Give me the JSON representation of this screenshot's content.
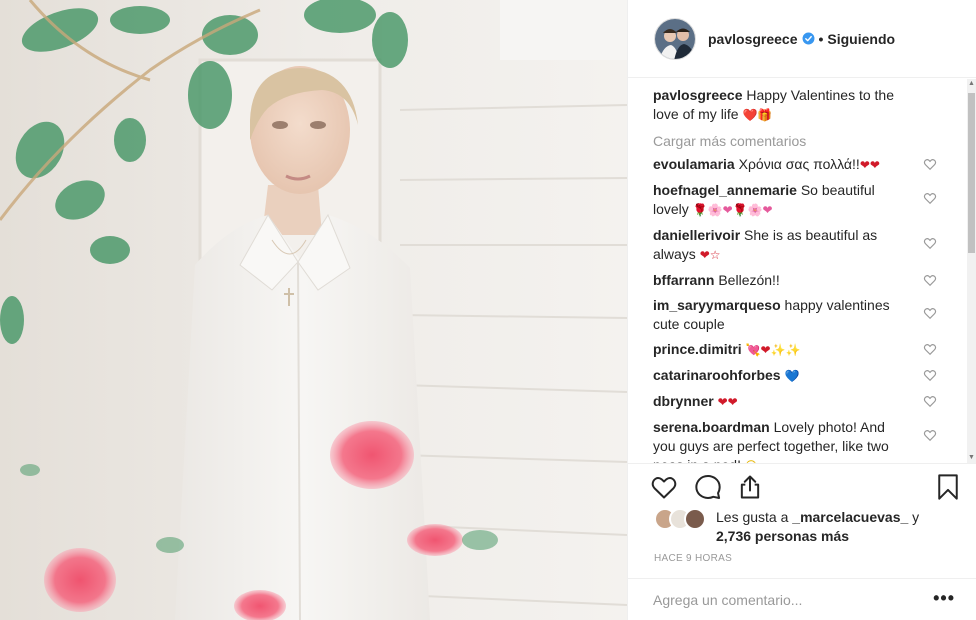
{
  "post": {
    "author": "pavlosgreece",
    "verified_icon": "verified-badge-icon",
    "separator": "•",
    "follow_status": "Siguiendo",
    "caption_text": "Happy Valentines to the love of my life",
    "caption_emoji": "❤️🎁",
    "load_more": "Cargar más comentarios",
    "likes_prefix": "Les gusta a",
    "likes_user": "_marcelacuevas_",
    "likes_and": "y",
    "likes_count": "2,736 personas más",
    "timestamp": "HACE 9 HORAS",
    "add_comment_placeholder": "Agrega un comentario...",
    "more_options": "•••"
  },
  "comments": [
    {
      "user": "evoulamaria",
      "text": "Χρόνια σας πολλά!!",
      "emoji": "❤❤"
    },
    {
      "user": "hoefnagel_annemarie",
      "text": "So beautiful lovely",
      "emoji": "🌹🌸❤🌹🌸❤"
    },
    {
      "user": "daniellerivoir",
      "text": "She is as beautiful as always",
      "emoji": "❤☆"
    },
    {
      "user": "bffarrann",
      "text": "Bellezón!!",
      "emoji": ""
    },
    {
      "user": "im_saryymarqueso",
      "text": "happy valentines cute couple",
      "emoji": ""
    },
    {
      "user": "prince.dimitri",
      "text": "",
      "emoji": "💘❤✨✨"
    },
    {
      "user": "catarinaroohforbes",
      "text": "",
      "emoji": "💙"
    },
    {
      "user": "dbrynner",
      "text": "",
      "emoji": "❤❤"
    },
    {
      "user": "serena.boardman",
      "text": "Lovely photo! And you guys are perfect together, like two peas in a pod!",
      "emoji": "😉"
    }
  ],
  "icons": {
    "like": "heart-outline-icon",
    "comment": "speech-bubble-icon",
    "share": "share-icon",
    "save": "bookmark-icon",
    "comment_like": "small-heart-icon"
  },
  "colors": {
    "verified": "#3897f0",
    "text": "#262626",
    "muted": "#999999",
    "border": "#efefef",
    "heart_emoji": "#d11a2a"
  }
}
